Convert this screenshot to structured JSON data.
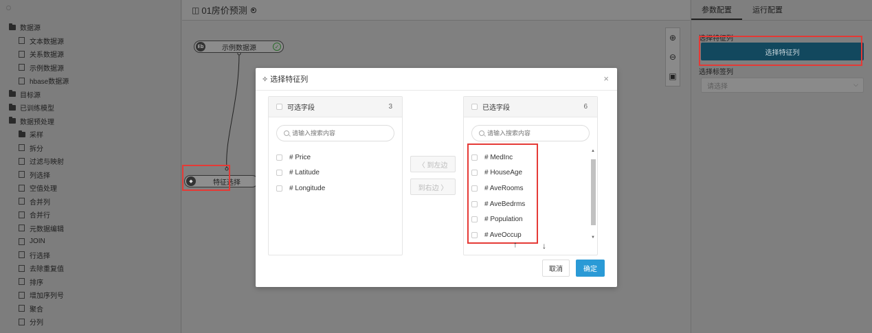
{
  "sidebar": {
    "items": [
      {
        "label": "数据源",
        "icon": "folder-icon",
        "level": 0
      },
      {
        "label": "文本数据源",
        "icon": "document-icon",
        "level": 1
      },
      {
        "label": "关系数据源",
        "icon": "document-icon",
        "level": 1
      },
      {
        "label": "示例数据源",
        "icon": "link-icon",
        "level": 1
      },
      {
        "label": "hbase数据源",
        "icon": "database-icon",
        "level": 1
      },
      {
        "label": "目标源",
        "icon": "folder-icon",
        "level": 0
      },
      {
        "label": "已训练模型",
        "icon": "folder-icon",
        "level": 0
      },
      {
        "label": "数据预处理",
        "icon": "folder-icon",
        "level": 0
      },
      {
        "label": "采样",
        "icon": "folder-icon",
        "level": 1
      },
      {
        "label": "拆分",
        "icon": "split-icon",
        "level": 1
      },
      {
        "label": "过滤与映射",
        "icon": "filter-icon",
        "level": 1
      },
      {
        "label": "列选择",
        "icon": "column-icon",
        "level": 1
      },
      {
        "label": "空值处理",
        "icon": "null-icon",
        "level": 1
      },
      {
        "label": "合并列",
        "icon": "merge-column-icon",
        "level": 1
      },
      {
        "label": "合并行",
        "icon": "merge-row-icon",
        "level": 1
      },
      {
        "label": "元数据编辑",
        "icon": "database-icon",
        "level": 1
      },
      {
        "label": "JOIN",
        "icon": "join-icon",
        "level": 1
      },
      {
        "label": "行选择",
        "icon": "row-icon",
        "level": 1
      },
      {
        "label": "去除重复值",
        "icon": "dedupe-icon",
        "level": 1
      },
      {
        "label": "排序",
        "icon": "sort-icon",
        "level": 1
      },
      {
        "label": "增加序列号",
        "icon": "sequence-icon",
        "level": 1
      },
      {
        "label": "聚合",
        "icon": "aggregate-icon",
        "level": 1
      },
      {
        "label": "分列",
        "icon": "split-column-icon",
        "level": 1
      }
    ]
  },
  "canvas": {
    "title": "01房价预测",
    "title_icon": "◫",
    "nodes": {
      "source": {
        "label": "示例数据源",
        "icon_text": "Eb"
      },
      "feature": {
        "label": "特征选择",
        "icon_text": "◆"
      }
    },
    "tools": [
      "⊕",
      "⊖",
      "▣"
    ]
  },
  "right_panel": {
    "tabs": [
      "参数配置",
      "运行配置"
    ],
    "feature_label": "选择特征列",
    "feature_button": "选择特征列",
    "label_label": "选择标签列",
    "label_placeholder": "请选择"
  },
  "modal": {
    "title": "选择特征列",
    "close": "×",
    "left": {
      "title": "可选字段",
      "count": "3",
      "search_placeholder": "请输入搜索内容",
      "items": [
        "# Price",
        "# Latitude",
        "# Longitude"
      ]
    },
    "right": {
      "title": "已选字段",
      "count": "6",
      "search_placeholder": "请输入搜索内容",
      "items": [
        "# MedInc",
        "# HouseAge",
        "# AveRooms",
        "# AveBedrms",
        "# Population",
        "# AveOccup"
      ]
    },
    "to_left": "〈 到左边",
    "to_right": "到右边 〉",
    "cancel": "取消",
    "confirm": "确定"
  },
  "colors": {
    "accent": "#2a9ad6",
    "highlight": "#e53935",
    "dark_button": "#12485e"
  }
}
